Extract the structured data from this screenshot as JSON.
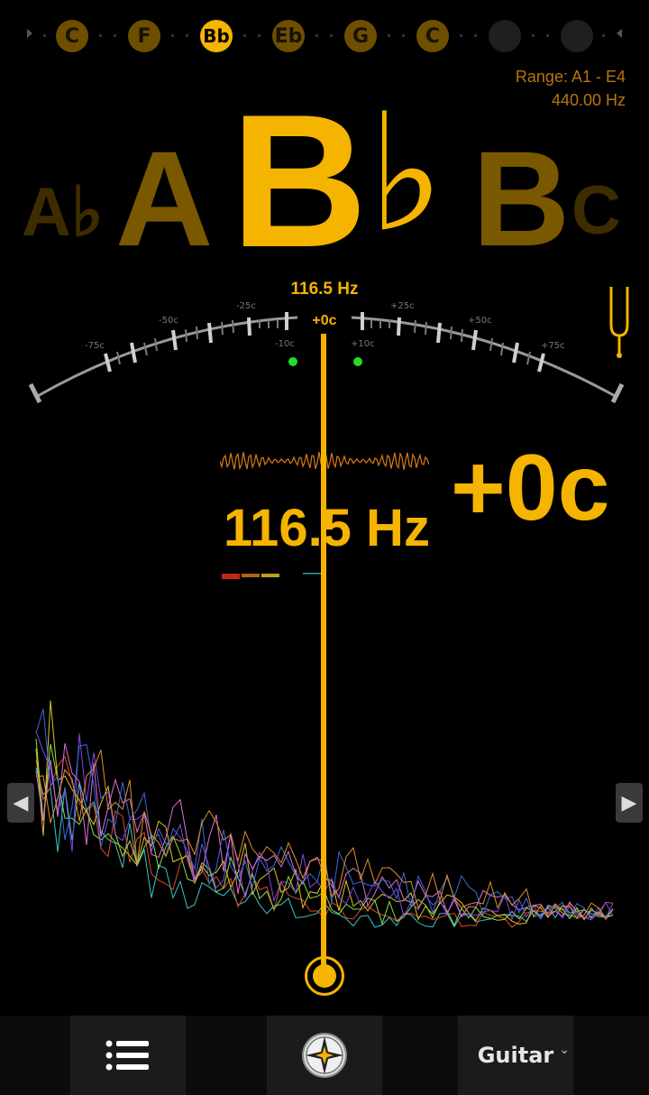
{
  "string_bar": {
    "notes": [
      "C",
      "F",
      "Bb",
      "Eb",
      "G",
      "C",
      "",
      ""
    ],
    "active_index": 2
  },
  "range": {
    "label": "Range: A1 - E4",
    "reference": "440.00 Hz"
  },
  "note_row": {
    "far_left": "A♭",
    "left": "A",
    "center": "B",
    "center_accidental": "♭",
    "right": "B",
    "far_right": "C"
  },
  "gauge": {
    "pitch_label": "116.5 Hz",
    "cents_label": "+0c",
    "ticks": {
      "minus75": "-75c",
      "minus50": "-50c",
      "minus25": "-25c",
      "minus10": "-10c",
      "plus10": "+10c",
      "plus25": "+25c",
      "plus50": "+50c",
      "plus75": "+75c"
    },
    "in_tune_color": "#22dd22",
    "deviation_cents": 0
  },
  "readout": {
    "frequency": "116.5 Hz",
    "cents": "+0c"
  },
  "nav": {
    "prev": "◀",
    "next": "▶"
  },
  "bottom_bar": {
    "instrument": "Guitar",
    "caret": "⌄"
  },
  "colors": {
    "accent": "#f5b400",
    "dim_accent": "#6e4f00",
    "range_text": "#b5760d"
  },
  "icons": {
    "tuning_fork": "tuning-fork-icon",
    "menu": "list-icon",
    "compass": "compass-icon"
  }
}
